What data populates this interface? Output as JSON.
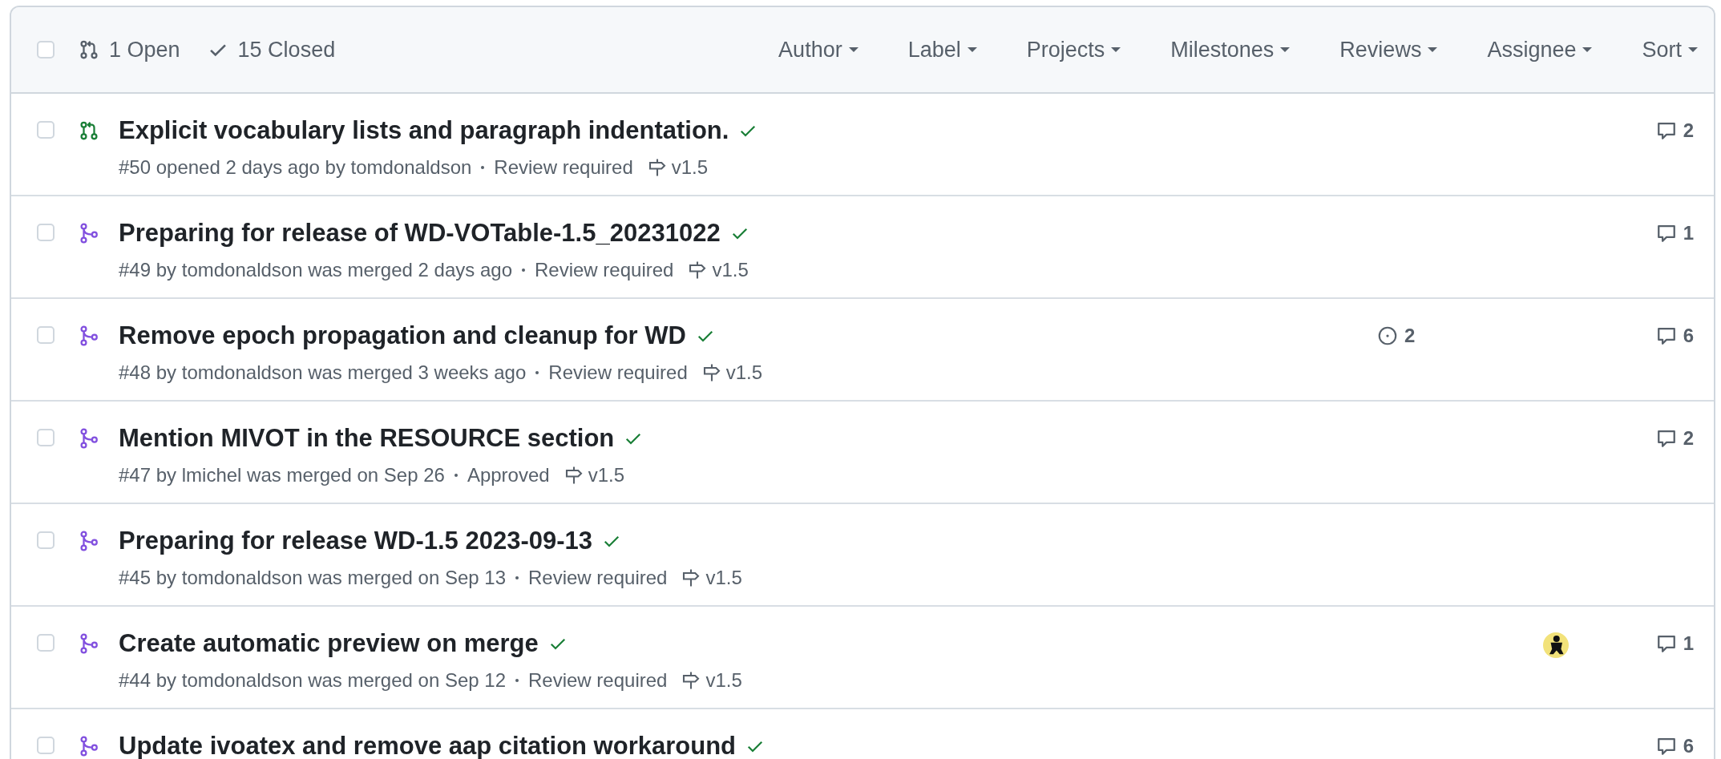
{
  "header": {
    "select_all": {
      "selected": false
    },
    "states": [
      {
        "kind": "open",
        "label": "1 Open",
        "selected": false
      },
      {
        "kind": "closed",
        "label": "15 Closed",
        "selected": false
      }
    ],
    "filters": [
      "Author",
      "Label",
      "Projects",
      "Milestones",
      "Reviews",
      "Assignee",
      "Sort"
    ]
  },
  "pull_requests": [
    {
      "selected": false,
      "kind": "open",
      "title": "Explicit vocabulary lists and paragraph indentation.",
      "checks_passed": true,
      "meta": "#50 opened 2 days ago by tomdonaldson",
      "review": "Review required",
      "milestone": "v1.5",
      "assignee": false,
      "comments": "2"
    },
    {
      "selected": false,
      "kind": "merged",
      "title": "Preparing for release of WD-VOTable-1.5_20231022",
      "checks_passed": true,
      "meta": "#49 by tomdonaldson was merged 2 days ago",
      "review": "Review required",
      "milestone": "v1.5",
      "assignee": false,
      "comments": "1"
    },
    {
      "selected": false,
      "kind": "merged",
      "title": "Remove epoch propagation and cleanup for WD",
      "checks_passed": true,
      "meta": "#48 by tomdonaldson was merged 3 weeks ago",
      "review": "Review required",
      "milestone": "v1.5",
      "linked_issues": "2",
      "assignee": false,
      "comments": "6"
    },
    {
      "selected": false,
      "kind": "merged",
      "title": "Mention MIVOT in the RESOURCE section",
      "checks_passed": true,
      "meta": "#47 by lmichel was merged on Sep 26",
      "review": "Approved",
      "milestone": "v1.5",
      "assignee": false,
      "comments": "2"
    },
    {
      "selected": false,
      "kind": "merged",
      "title": "Preparing for release WD-1.5 2023-09-13",
      "checks_passed": true,
      "meta": "#45 by tomdonaldson was merged on Sep 13",
      "review": "Review required",
      "milestone": "v1.5",
      "assignee": false
    },
    {
      "selected": false,
      "kind": "merged",
      "title": "Create automatic preview on merge",
      "checks_passed": true,
      "meta": "#44 by tomdonaldson was merged on Sep 12",
      "review": "Review required",
      "milestone": "v1.5",
      "assignee": true,
      "comments": "1"
    },
    {
      "selected": false,
      "kind": "merged",
      "title": "Update ivoatex and remove aap citation workaround",
      "checks_passed": true,
      "assignee": false,
      "comments": "6"
    }
  ]
}
